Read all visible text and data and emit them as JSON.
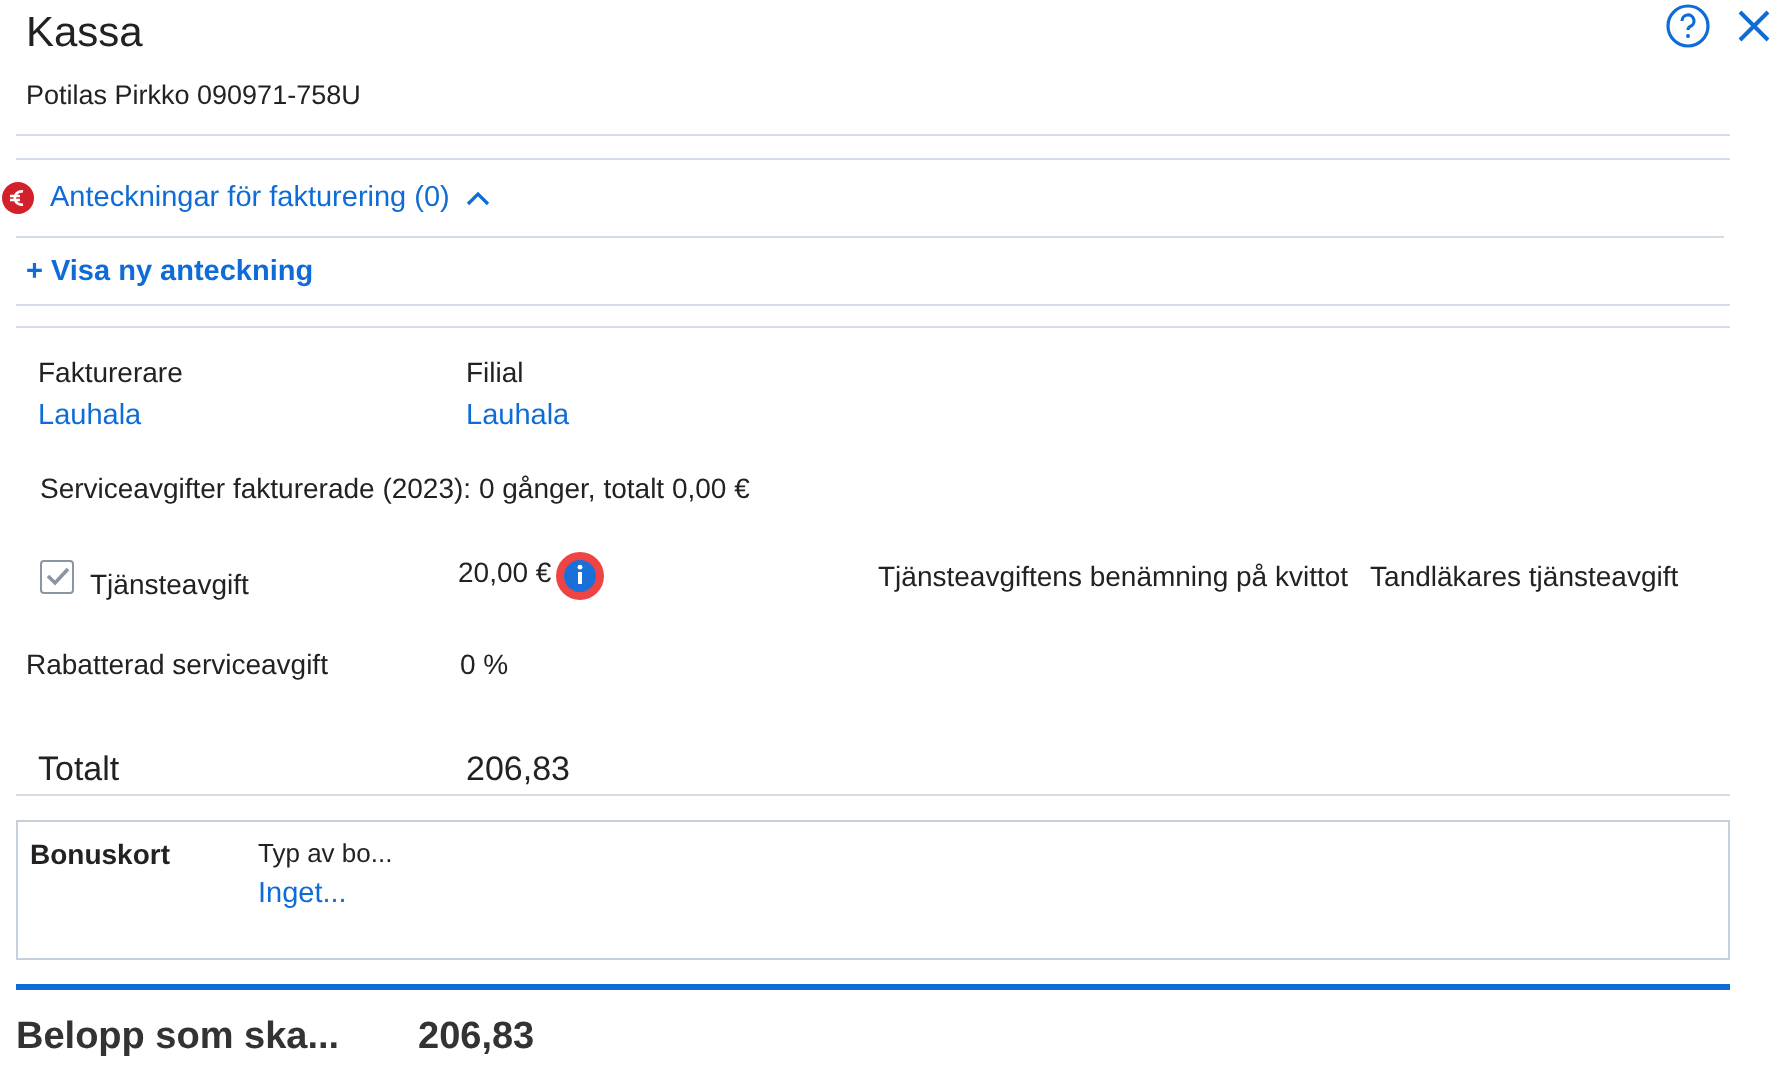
{
  "header": {
    "title": "Kassa",
    "patient": "Potilas Pirkko 090971-758U"
  },
  "notes": {
    "label": "Anteckningar för fakturering (0)",
    "expanded": true,
    "add_link": "+ Visa ny anteckning"
  },
  "billing": {
    "biller_label": "Fakturerare",
    "biller": "Lauhala",
    "branch_label": "Filial",
    "branch": "Lauhala"
  },
  "service_summary": "Serviceavgifter fakturerade (2023): 0 gånger, totalt 0,00 €",
  "service_fee": {
    "label": "Tjänsteavgift",
    "checked": true,
    "amount": "20,00 €",
    "receipt_label": "Tjänsteavgiftens benämning på kvittot",
    "receipt_name": "Tandläkares tjänsteavgift"
  },
  "discount": {
    "label": "Rabatterad serviceavgift",
    "value": "0 %"
  },
  "total": {
    "label": "Totalt",
    "value": "206,83"
  },
  "bonus": {
    "label": "Bonuskort",
    "type_label": "Typ av bo...",
    "type_value": "Inget..."
  },
  "amount_due": {
    "label": "Belopp som ska...",
    "value": "206,83"
  }
}
